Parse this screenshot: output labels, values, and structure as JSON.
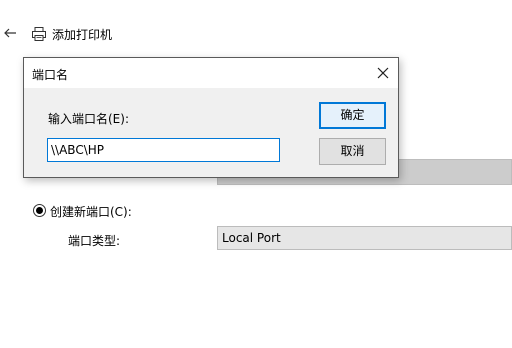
{
  "wizard": {
    "title": "添加打印机"
  },
  "port_options": {
    "create_new_label": "创建新端口(C):",
    "create_new_selected": true,
    "port_type_label": "端口类型:",
    "port_type_value": "Local Port"
  },
  "dialog": {
    "title": "端口名",
    "prompt": "输入端口名(E):",
    "input_value": "\\\\ABC\\HP",
    "ok_label": "确定",
    "cancel_label": "取消"
  },
  "colors": {
    "accent": "#0078d7",
    "button_bg": "#e1e1e1",
    "dialog_bg": "#f0f0f0"
  },
  "icons": [
    "back-arrow-icon",
    "printer-icon",
    "close-icon"
  ]
}
